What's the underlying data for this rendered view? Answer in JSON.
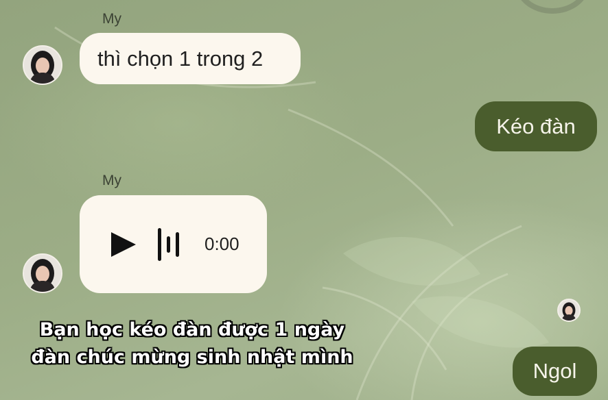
{
  "colors": {
    "background": "#9aaa84",
    "incoming_bubble": "#fcf7ee",
    "outgoing_bubble": "#4a5d2d",
    "outgoing_text": "#f6f4ea"
  },
  "messages": [
    {
      "direction": "incoming",
      "sender": "My",
      "type": "text",
      "text": "thì chọn 1 trong 2"
    },
    {
      "direction": "outgoing",
      "type": "text",
      "text": "Kéo đàn"
    },
    {
      "direction": "incoming",
      "sender": "My",
      "type": "voice",
      "duration": "0:00",
      "icon": "play-icon"
    },
    {
      "direction": "outgoing",
      "type": "text",
      "text": "Ngol",
      "read_receipt_avatar": true
    }
  ],
  "caption": {
    "line1": "Bạn học kéo đàn được 1 ngày",
    "line2": "đàn chúc mừng sinh nhật mình"
  }
}
